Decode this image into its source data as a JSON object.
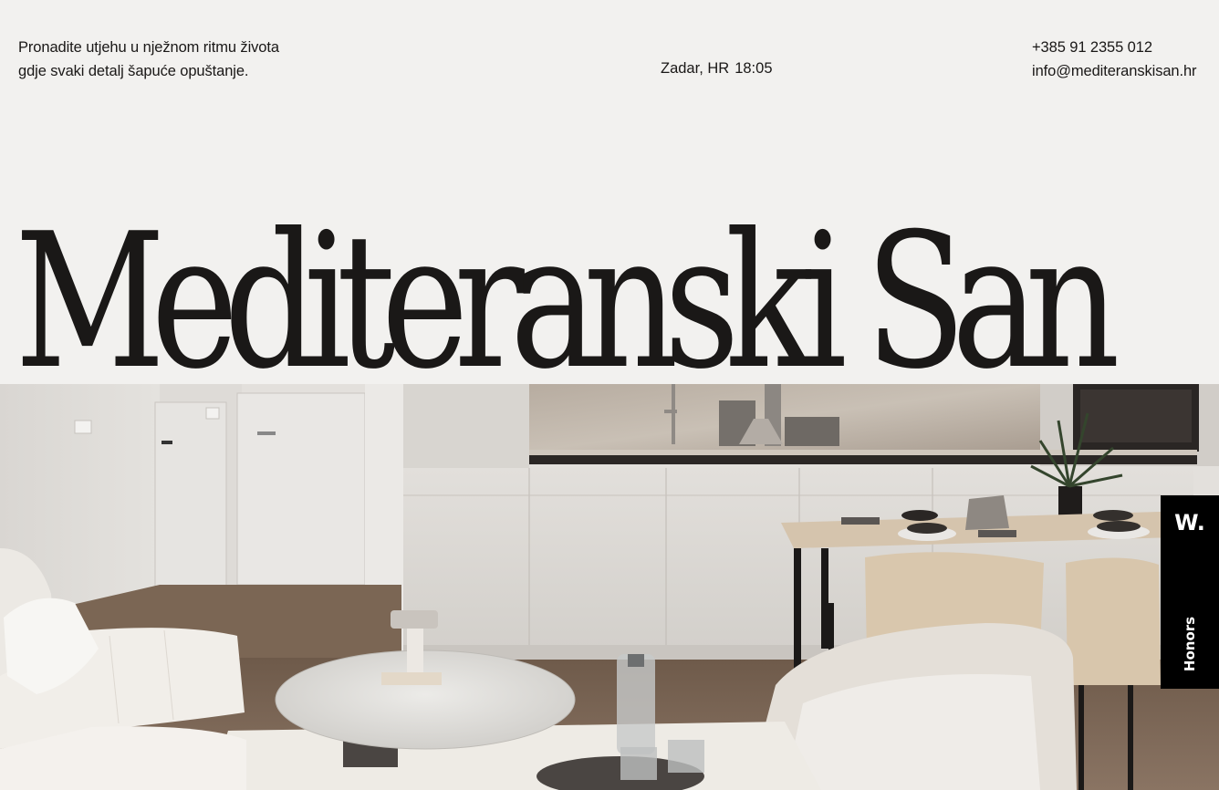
{
  "header": {
    "tagline": [
      "Pronadite utjehu u nježnom ritmu života",
      "gdje svaki detalj šapuće opuštanje."
    ],
    "location": "Zadar, HR",
    "time": "18:05",
    "phone": "+385 91 2355 012",
    "email": "info@mediteranskisan.hr"
  },
  "hero": {
    "title": "Mediteranski San",
    "image": "apartment-interior-living-kitchen-dining"
  },
  "honors_badge": {
    "logo": "W.",
    "label": "Honors"
  },
  "colors": {
    "background": "#f2f1ef",
    "text": "#1a1817",
    "badge": "#000000"
  }
}
